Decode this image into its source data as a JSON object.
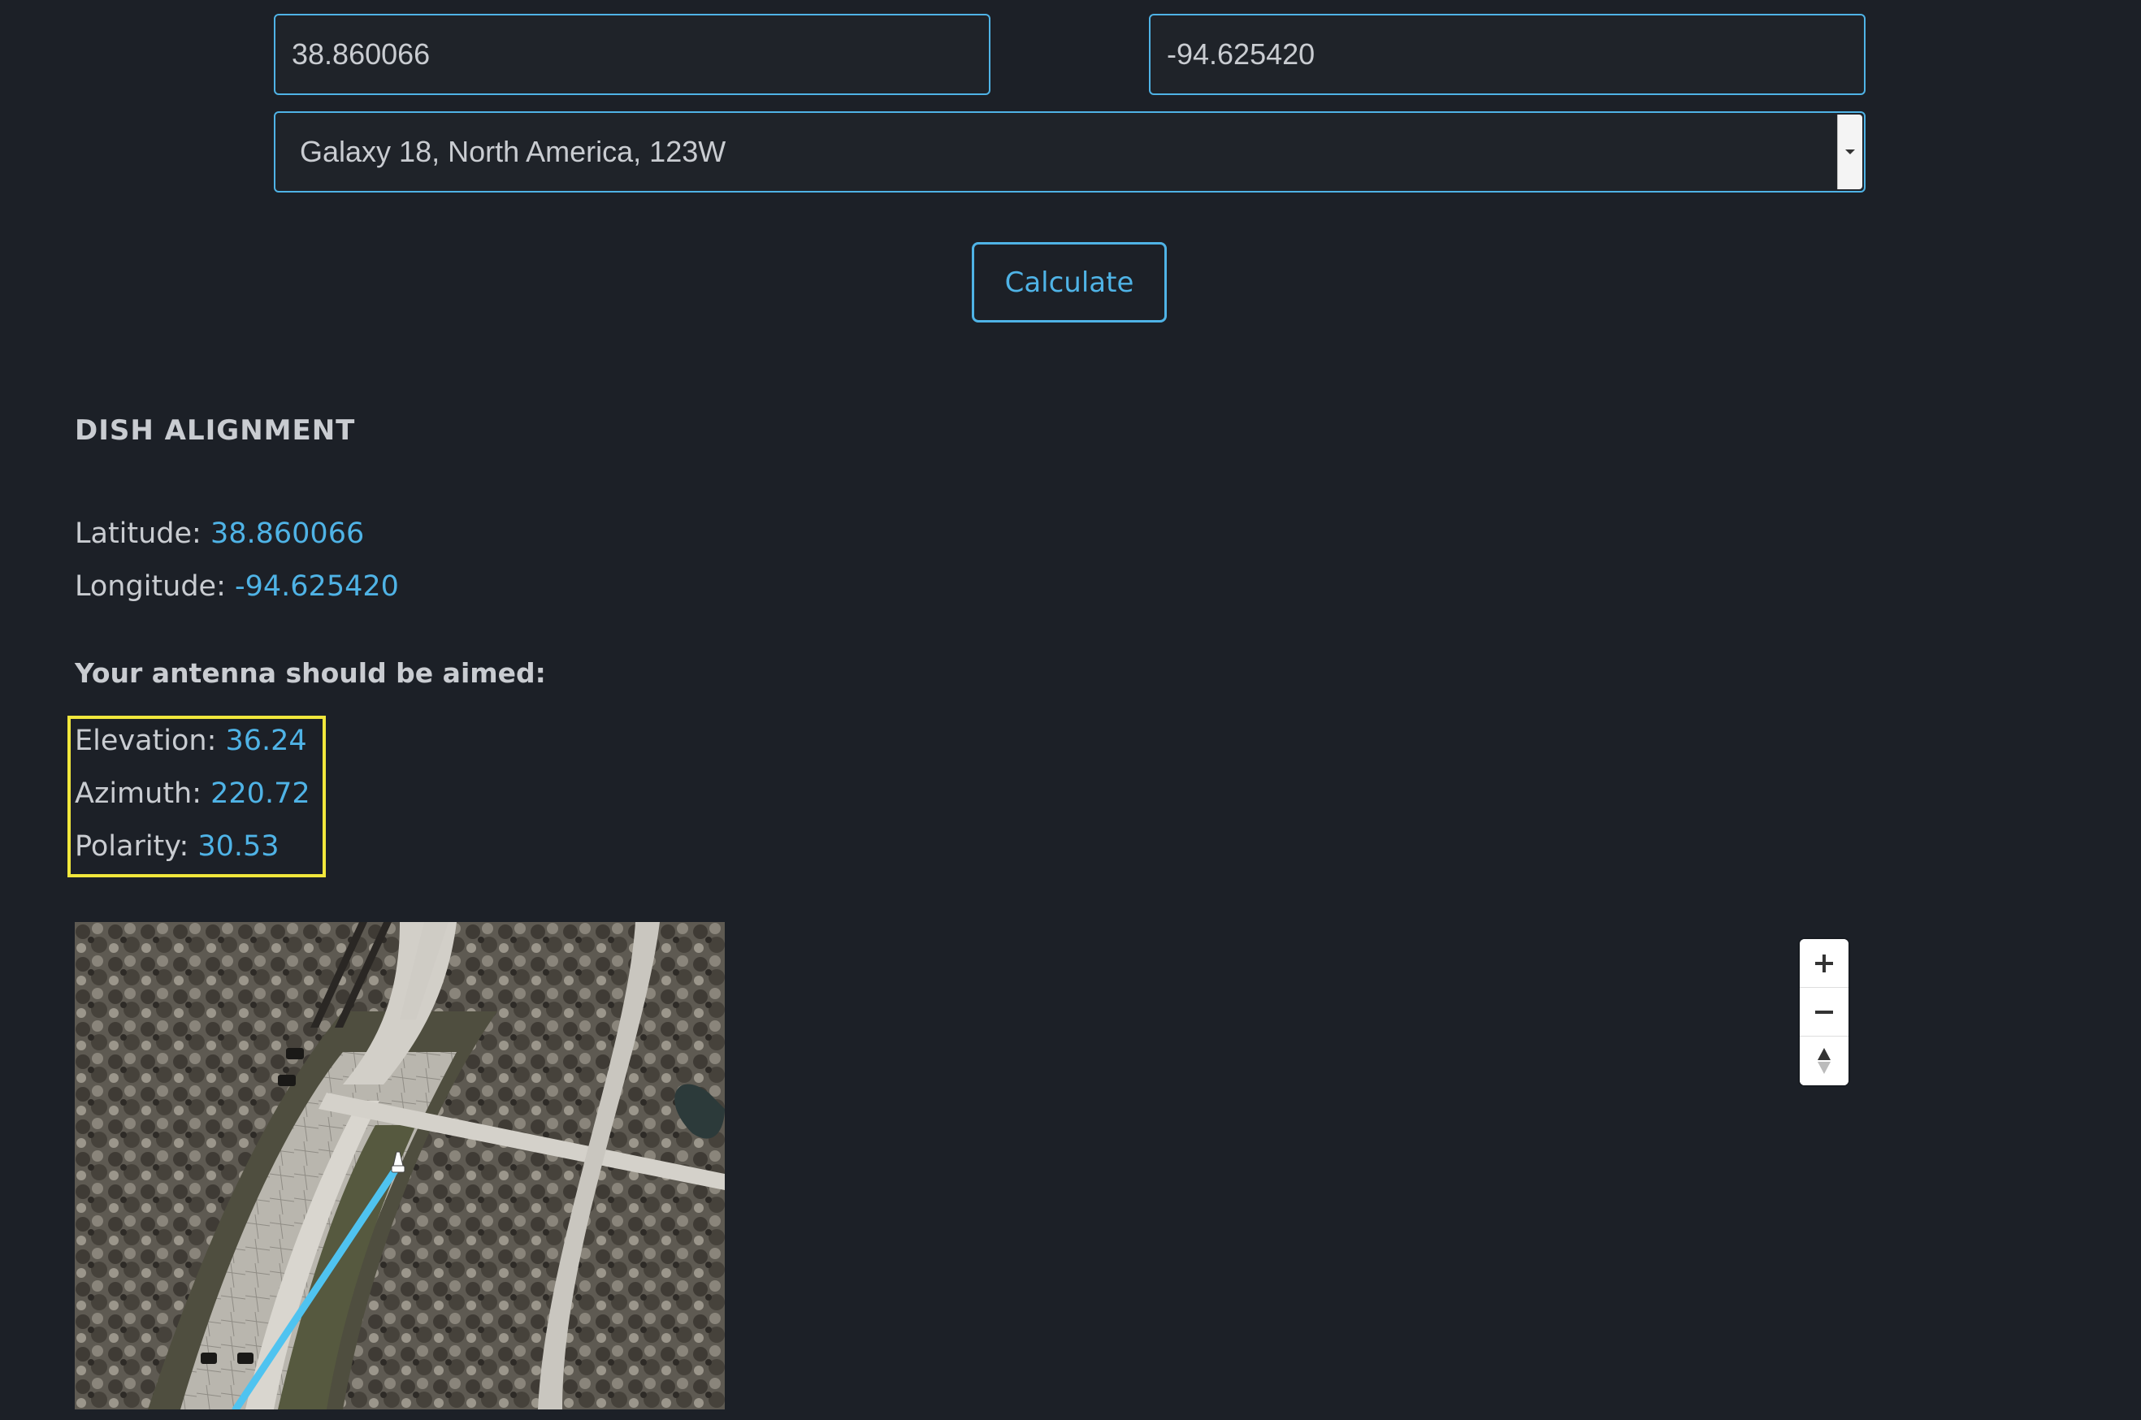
{
  "form": {
    "latitude_value": "38.860066",
    "longitude_value": "-94.625420",
    "satellite_selected": "Galaxy 18, North America, 123W",
    "calculate_label": "Calculate"
  },
  "results": {
    "heading": "DISH ALIGNMENT",
    "latitude_label": "Latitude: ",
    "latitude_value": "38.860066",
    "longitude_label": "Longitude: ",
    "longitude_value": "-94.625420",
    "aim_title": "Your antenna should be aimed:",
    "elevation_label": "Elevation: ",
    "elevation_value": "36.24",
    "azimuth_label": "Azimuth: ",
    "azimuth_value": "220.72",
    "polarity_label": "Polarity: ",
    "polarity_value": "30.53"
  },
  "map_controls": {
    "zoom_in_icon": "plus-icon",
    "zoom_out_icon": "minus-icon",
    "compass_icon": "compass-icon"
  },
  "colors": {
    "background": "#1c2027",
    "accent": "#4fb3e6",
    "highlight": "#f1e73c",
    "text": "#c9ccd1"
  }
}
